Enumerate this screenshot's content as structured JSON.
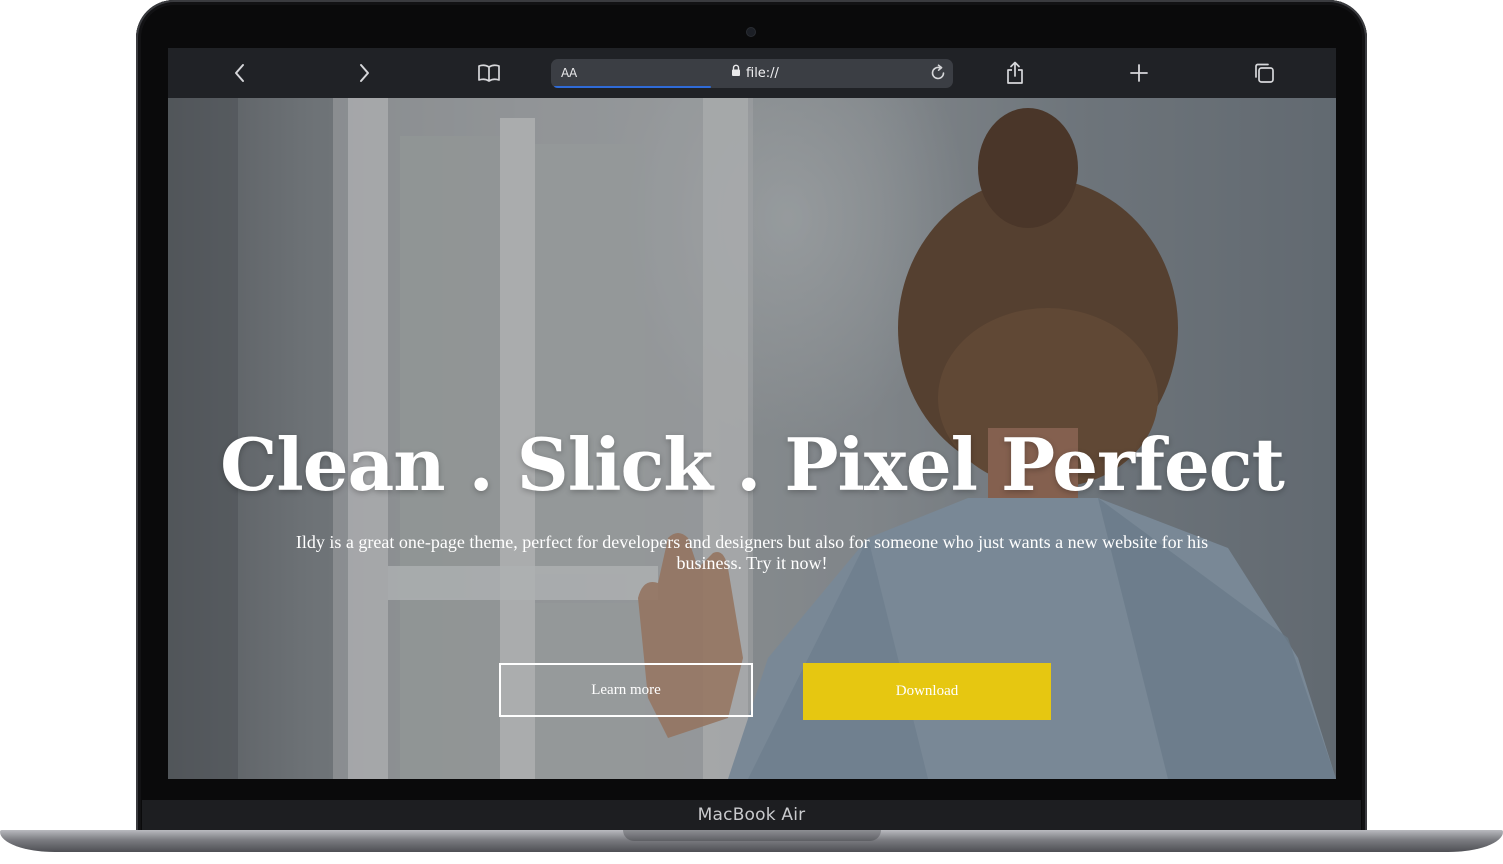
{
  "device": {
    "label": "MacBook Air"
  },
  "browser": {
    "url_text_size_label": "AA",
    "url": "file://",
    "toolbar_icons": {
      "back": "chevron-left-icon",
      "forward": "chevron-right-icon",
      "bookmarks": "book-icon",
      "secure": "lock-icon",
      "reload": "reload-icon",
      "share": "share-icon",
      "new_tab": "plus-icon",
      "tabs": "tabs-icon"
    },
    "load_progress": 0.39
  },
  "hero": {
    "title": "Clean . Slick . Pixel Perfect",
    "subtitle": "Ildy is a great one-page theme, perfect for developers and designers but also for someone who just wants a new website for his business. Try it now!",
    "primary_button": "Learn more",
    "secondary_button": "Download"
  },
  "colors": {
    "toolbar_bg": "#202226",
    "url_bar_bg": "#3b3e44",
    "progress": "#2f6bd8",
    "download_button": "#e6c711",
    "text": "#ffffff"
  }
}
